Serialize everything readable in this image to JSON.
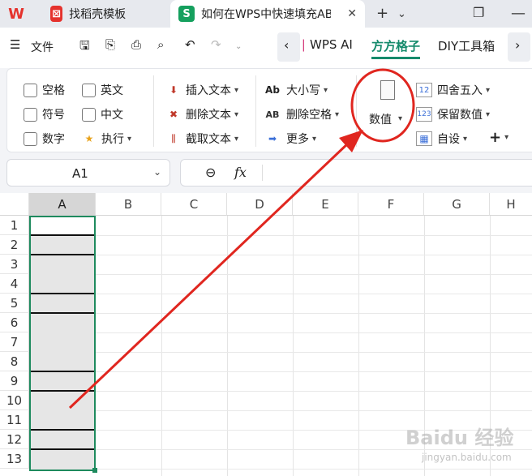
{
  "tabs": [
    {
      "label": "找稻壳模板",
      "icon": "W",
      "color": "#e5322d"
    },
    {
      "label": "如何在WPS中快速填充AB",
      "icon": "S",
      "color": "#15a05e"
    }
  ],
  "toolbar": {
    "file": "文件",
    "ribbon_tabs": [
      "WPS AI",
      "方方格子",
      "DIY工具箱"
    ],
    "active_tab": "方方格子"
  },
  "ribbon": {
    "checks": [
      "空格",
      "英文",
      "符号",
      "中文",
      "数字"
    ],
    "exec": "执行",
    "text_group": [
      "插入文本",
      "删除文本",
      "截取文本"
    ],
    "case_group": [
      "大小写",
      "删除空格",
      "更多"
    ],
    "value_button": "数值",
    "round_group": [
      "四舍五入",
      "保留数值",
      "自设"
    ],
    "plus": "+"
  },
  "formula_bar": {
    "cell": "A1",
    "zoom_icon": "⊖",
    "fx": "fx"
  },
  "sheet": {
    "columns": [
      "A",
      "B",
      "C",
      "D",
      "E",
      "F",
      "G",
      "H"
    ],
    "rows": [
      "1",
      "2",
      "3",
      "4",
      "5",
      "6",
      "7",
      "8",
      "9",
      "10",
      "11",
      "12",
      "13"
    ]
  },
  "watermark": {
    "main": "Baidu 经验",
    "sub": "jingyan.baidu.com"
  },
  "colors": {
    "accent": "#148a6b",
    "annotation": "#e0261f"
  }
}
